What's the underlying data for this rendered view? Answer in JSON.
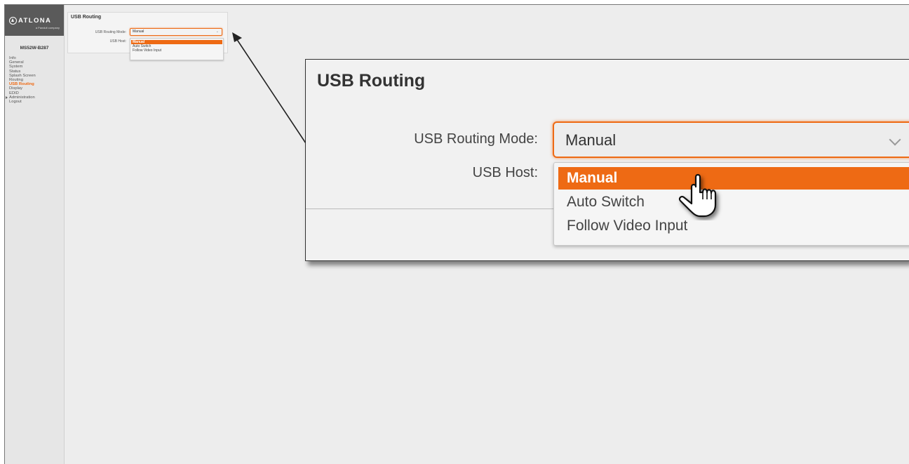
{
  "sidebar": {
    "logo_text": "ATLONA",
    "logo_sub": "a Panduit company",
    "device_name": "MS52W-B287",
    "items": [
      {
        "label": "Info"
      },
      {
        "label": "General"
      },
      {
        "label": "System"
      },
      {
        "label": "Status"
      },
      {
        "label": "Splash Screen"
      },
      {
        "label": "Routing"
      },
      {
        "label": "USB Routing"
      },
      {
        "label": "Display"
      },
      {
        "label": "EDID"
      },
      {
        "label": "Administration"
      },
      {
        "label": "Logout"
      }
    ]
  },
  "panel": {
    "title": "USB Routing",
    "mode_label": "USB Routing Mode:",
    "host_label": "USB Host:",
    "selected": "Manual",
    "options": [
      "Manual",
      "Auto Switch",
      "Follow Video Input"
    ]
  },
  "colors": {
    "accent": "#ee6a14",
    "sidebar_bg": "#e6e6e6",
    "logo_bg": "#5a5a5a"
  },
  "icons": {
    "dropdown": "chevron-down-icon",
    "pointer": "hand-pointer-icon",
    "callout": "arrow-icon"
  }
}
